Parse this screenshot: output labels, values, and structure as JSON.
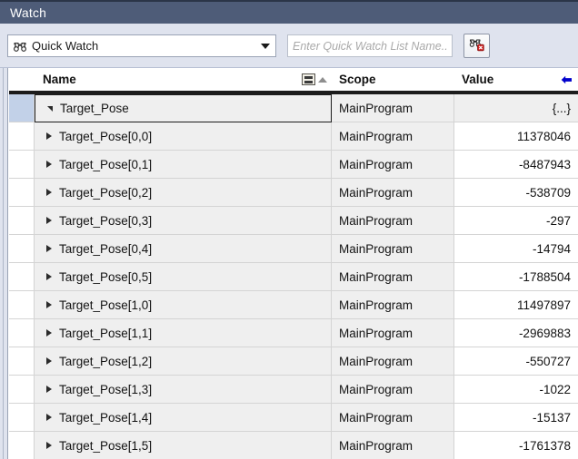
{
  "window": {
    "title": "Watch"
  },
  "toolbar": {
    "list_selector": {
      "icon": "binoculars-icon",
      "selected": "Quick Watch",
      "arrow_icon": "chevron-down-icon"
    },
    "list_name_field": {
      "value": "",
      "placeholder": "Enter Quick Watch List Name..."
    },
    "action_button": {
      "icon": "delete-quick-watch-list-icon",
      "label": ""
    }
  },
  "grid": {
    "columns": [
      {
        "key": "gutter",
        "label": ""
      },
      {
        "key": "name",
        "label": "Name"
      },
      {
        "key": "scope",
        "label": "Scope"
      },
      {
        "key": "value",
        "label": "Value"
      }
    ],
    "header_icons": {
      "filter": "column-filter-icon",
      "sort": "sort-ascending-icon",
      "value_arrow": "left-arrow-icon"
    },
    "accent_color": "#0000cc",
    "rows": [
      {
        "name": "Target_Pose",
        "scope": "MainProgram",
        "value": "{...}",
        "level": 0,
        "expanded": true,
        "selected": true
      },
      {
        "name": "Target_Pose[0,0]",
        "scope": "MainProgram",
        "value": "11378046",
        "level": 1,
        "expanded": false,
        "selected": false
      },
      {
        "name": "Target_Pose[0,1]",
        "scope": "MainProgram",
        "value": "-8487943",
        "level": 1,
        "expanded": false,
        "selected": false
      },
      {
        "name": "Target_Pose[0,2]",
        "scope": "MainProgram",
        "value": "-538709",
        "level": 1,
        "expanded": false,
        "selected": false
      },
      {
        "name": "Target_Pose[0,3]",
        "scope": "MainProgram",
        "value": "-297",
        "level": 1,
        "expanded": false,
        "selected": false
      },
      {
        "name": "Target_Pose[0,4]",
        "scope": "MainProgram",
        "value": "-14794",
        "level": 1,
        "expanded": false,
        "selected": false
      },
      {
        "name": "Target_Pose[0,5]",
        "scope": "MainProgram",
        "value": "-1788504",
        "level": 1,
        "expanded": false,
        "selected": false
      },
      {
        "name": "Target_Pose[1,0]",
        "scope": "MainProgram",
        "value": "11497897",
        "level": 1,
        "expanded": false,
        "selected": false
      },
      {
        "name": "Target_Pose[1,1]",
        "scope": "MainProgram",
        "value": "-2969883",
        "level": 1,
        "expanded": false,
        "selected": false
      },
      {
        "name": "Target_Pose[1,2]",
        "scope": "MainProgram",
        "value": "-550727",
        "level": 1,
        "expanded": false,
        "selected": false
      },
      {
        "name": "Target_Pose[1,3]",
        "scope": "MainProgram",
        "value": "-1022",
        "level": 1,
        "expanded": false,
        "selected": false
      },
      {
        "name": "Target_Pose[1,4]",
        "scope": "MainProgram",
        "value": "-15137",
        "level": 1,
        "expanded": false,
        "selected": false
      },
      {
        "name": "Target_Pose[1,5]",
        "scope": "MainProgram",
        "value": "-1761378",
        "level": 1,
        "expanded": false,
        "selected": false
      }
    ]
  }
}
